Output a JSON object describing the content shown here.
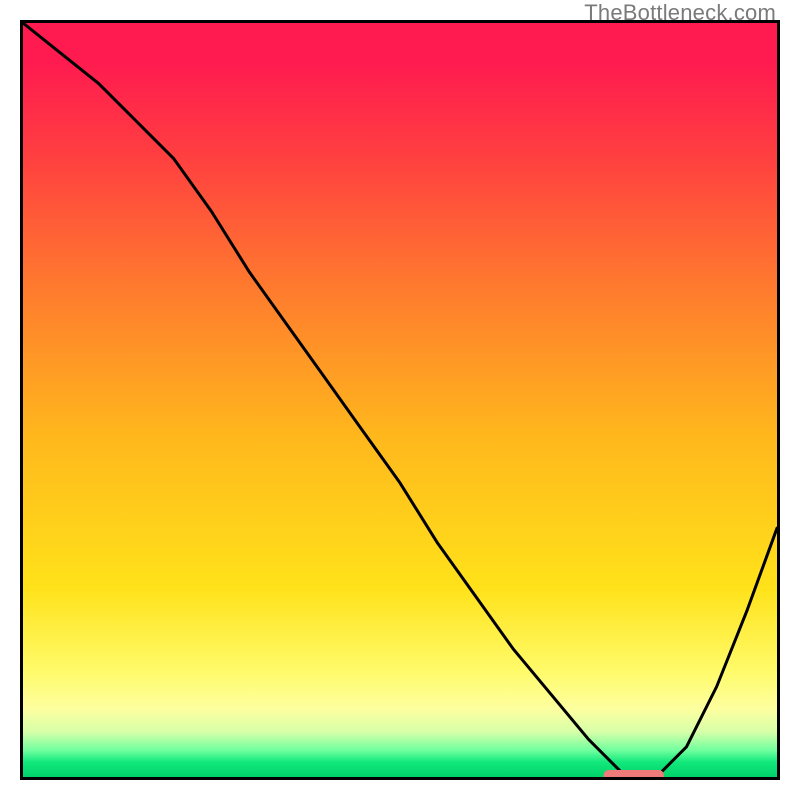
{
  "watermark": "TheBottleneck.com",
  "colors": {
    "curve_stroke": "#000000",
    "marker_fill": "#ee7b79",
    "border": "#000000"
  },
  "chart_data": {
    "type": "line",
    "title": "",
    "xlabel": "",
    "ylabel": "",
    "xlim": [
      0,
      100
    ],
    "ylim": [
      0,
      100
    ],
    "gradient_background": {
      "direction": "vertical",
      "stops": [
        {
          "pos": 0,
          "color": "#ff1a50"
        },
        {
          "pos": 0.05,
          "color": "#ff1a50"
        },
        {
          "pos": 0.18,
          "color": "#ff4040"
        },
        {
          "pos": 0.35,
          "color": "#ff7a2e"
        },
        {
          "pos": 0.55,
          "color": "#ffb81c"
        },
        {
          "pos": 0.75,
          "color": "#ffe21a"
        },
        {
          "pos": 0.86,
          "color": "#fffb6a"
        },
        {
          "pos": 0.91,
          "color": "#fdffa0"
        },
        {
          "pos": 0.94,
          "color": "#d7ffa8"
        },
        {
          "pos": 0.965,
          "color": "#6fff9e"
        },
        {
          "pos": 0.98,
          "color": "#12e87c"
        },
        {
          "pos": 1.0,
          "color": "#00d26a"
        }
      ]
    },
    "series": [
      {
        "name": "bottleneck-curve",
        "x": [
          0,
          5,
          10,
          15,
          20,
          25,
          30,
          35,
          40,
          45,
          50,
          55,
          60,
          65,
          70,
          75,
          78,
          80,
          84,
          88,
          92,
          96,
          100
        ],
        "y": [
          100,
          96,
          92,
          87,
          82,
          75,
          67,
          60,
          53,
          46,
          39,
          31,
          24,
          17,
          11,
          5,
          2,
          0,
          0,
          4,
          12,
          22,
          33
        ]
      }
    ],
    "optimum_marker": {
      "x_start": 77,
      "x_end": 85,
      "y": 0
    }
  }
}
